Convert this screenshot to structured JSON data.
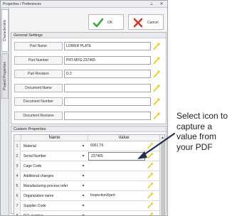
{
  "window": {
    "title": "Properties / Preferences",
    "pin_icon": "pin-icon",
    "close_icon": "close-icon"
  },
  "vertical_tabs": [
    {
      "label": "Characteristic",
      "active": true
    },
    {
      "label": "Project Properties",
      "active": false
    }
  ],
  "actions": {
    "ok_label": "OK",
    "cancel_label": "Cancel",
    "ok_color": "#3aa832",
    "cancel_color": "#d9322b"
  },
  "general_settings": {
    "title": "General Settings",
    "fields": [
      {
        "label": "Part Name",
        "value": "LOWER PLATE"
      },
      {
        "label": "Part Number",
        "value": "PRT-MFG-237465"
      },
      {
        "label": "Part Revision",
        "value": "D.2"
      },
      {
        "label": "Document Name",
        "value": ""
      },
      {
        "label": "Document Number",
        "value": ""
      },
      {
        "label": "Document Revision",
        "value": ""
      }
    ]
  },
  "custom_properties": {
    "title": "Custom Properties",
    "columns": {
      "name": "Name",
      "value": "Value"
    },
    "rows": [
      {
        "num": "1",
        "name": "Material",
        "value": "6061 T6"
      },
      {
        "num": "2",
        "name": "Serial Number",
        "value": "237465"
      },
      {
        "num": "3",
        "name": "Cage Code",
        "value": ""
      },
      {
        "num": "4",
        "name": "Additional changes",
        "value": ""
      },
      {
        "num": "5",
        "name": "Manufacturing process refer",
        "value": ""
      },
      {
        "num": "6",
        "name": "Organization name",
        "value": "InspectionXpert"
      },
      {
        "num": "7",
        "name": "Supplier Code",
        "value": ""
      },
      {
        "num": "8",
        "name": "P.O. number",
        "value": ""
      }
    ]
  },
  "annotation": {
    "text": "Select icon to capture a value from your PDF",
    "arrow_color": "#1f2f4d"
  },
  "capture_icon_color": "#e8c800"
}
